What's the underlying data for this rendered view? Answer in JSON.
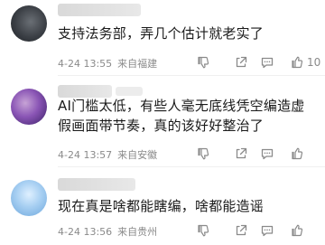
{
  "comments": [
    {
      "text": "支持法务部，弄几个估计就老实了",
      "time": "4-24 13:55",
      "location": "来自福建",
      "likes": "10"
    },
    {
      "text": "AI门槛太低，有些人毫无底线凭空编造虚假画面带节奏，真的该好好整治了",
      "time": "4-24 13:57",
      "location": "来自安徽",
      "likes": ""
    },
    {
      "text": "现在真是啥都能瞎编，啥都能造谣",
      "time": "4-24 13:56",
      "location": "来自贵州",
      "likes": ""
    }
  ]
}
